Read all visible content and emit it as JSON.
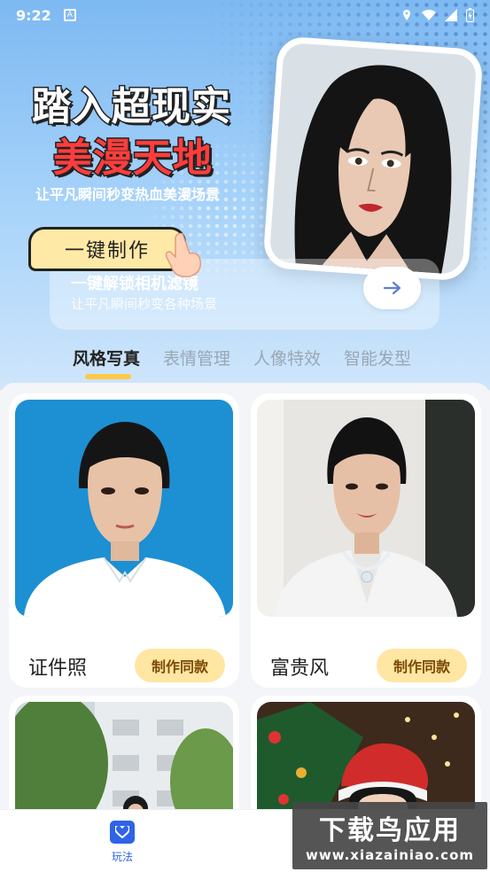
{
  "status_bar": {
    "time": "9:22",
    "notification_glyph": "A",
    "icons": [
      "location-icon",
      "wifi-icon",
      "signal-icon",
      "battery-icon"
    ]
  },
  "hero": {
    "title_line1": "踏入超现实",
    "title_line2": "美漫天地",
    "subtitle": "让平凡瞬间秒变热血美漫场景",
    "make_button": "一键制作",
    "panel_title": "一键解锁相机滤镜",
    "panel_subtitle": "让平凡瞬间秒变各种场景"
  },
  "tabs": [
    {
      "label": "风格写真",
      "active": true
    },
    {
      "label": "表情管理",
      "active": false
    },
    {
      "label": "人像特效",
      "active": false
    },
    {
      "label": "智能发型",
      "active": false
    }
  ],
  "cards": [
    {
      "label": "证件照",
      "button": "制作同款"
    },
    {
      "label": "富贵风",
      "button": "制作同款"
    },
    {
      "label": "",
      "button": ""
    },
    {
      "label": "",
      "button": ""
    }
  ],
  "bottom_nav": {
    "items": [
      {
        "label": "玩法",
        "icon": "heart-icon",
        "active": true
      }
    ]
  },
  "watermark": {
    "line1": "下载鸟应用",
    "line2": "www.xiazainiao.com"
  },
  "colors": {
    "accent_blue": "#2f63e8",
    "tab_underline": "#ffc94a",
    "use_button_bg": "#ffe6a2",
    "title_red": "#ff3d3d"
  }
}
